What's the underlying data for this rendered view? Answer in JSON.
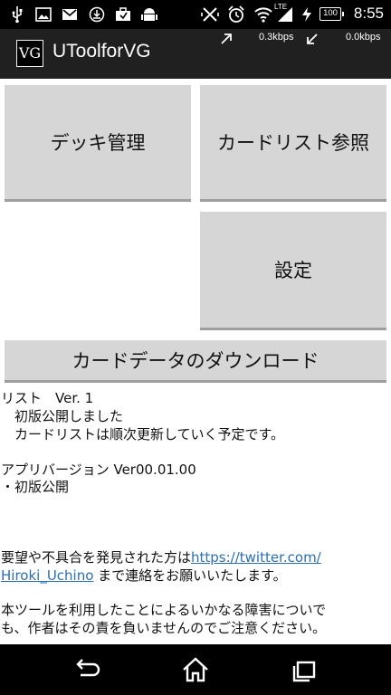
{
  "status_bar": {
    "time": "8:55",
    "battery": "100",
    "network_type": "LTE",
    "icons": [
      "usb-icon",
      "image-icon",
      "gmail-icon",
      "download-icon",
      "briefcase-icon",
      "android-icon",
      "vibrate-off-icon",
      "alarm-icon",
      "wifi-icon",
      "signal-icon",
      "charging-icon"
    ]
  },
  "action_bar": {
    "logo_text": "VG",
    "title": "UToolforVG",
    "upload_speed": "0.3kbps",
    "download_speed": "0.0kbps"
  },
  "tiles": {
    "deck_label": "デッキ管理",
    "cardlist_label": "カードリスト参照",
    "settings_label": "設定",
    "download_label": "カードデータのダウンロード"
  },
  "info": {
    "list_title": "リスト　Ver. 1",
    "list_line1": "　初版公開しました",
    "list_line2": "　カードリストは順次更新していく予定です。",
    "app_version": "アプリバージョン Ver00.01.00",
    "app_note": "・初版公開",
    "feedback_pre": "要望や不具合を発見された方は",
    "feedback_link1": "https://twitter.com/",
    "feedback_link2": "Hiroki_Uchino",
    "feedback_post": " まで連絡をお願いいたします。",
    "disclaimer1": "本ツールを利用したことによるいかなる障害についで",
    "disclaimer2": "も、作者はその責を負いませんのでご注意ください。"
  },
  "nav": {
    "buttons": [
      "back-icon",
      "home-icon",
      "recents-icon"
    ]
  }
}
